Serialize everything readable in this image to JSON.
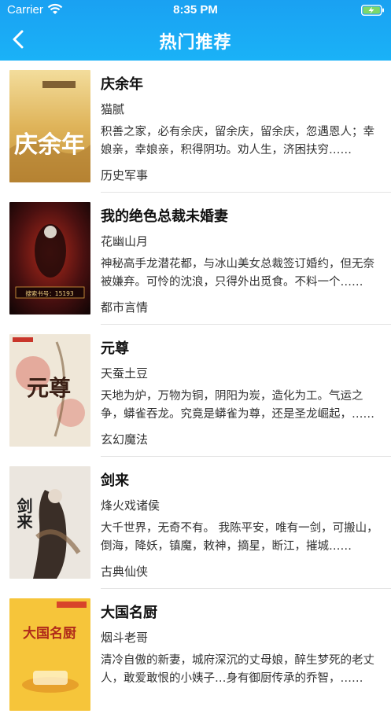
{
  "status_bar": {
    "carrier": "Carrier",
    "time": "8:35 PM"
  },
  "nav": {
    "title": "热门推荐"
  },
  "books": [
    {
      "title": "庆余年",
      "author": "猫腻",
      "description": "积善之家，必有余庆，留余庆，留余庆，忽遇恩人；幸娘亲，幸娘亲，积得阴功。劝人生，济困扶穷……",
      "genre": "历史军事",
      "cover_text": "庆余年",
      "cover_colors": [
        "#e9c67a",
        "#c89a3a"
      ]
    },
    {
      "title": "我的绝色总裁未婚妻",
      "author": "花幽山月",
      "description": "神秘高手龙潜花都，与冰山美女总裁签订婚约，但无奈被嫌弃。可怜的沈浪，只得外出觅食。不料一个……",
      "genre": "都市言情",
      "cover_text": "搜索书号：15193",
      "cover_colors": [
        "#2a0d0d",
        "#7a1a12"
      ]
    },
    {
      "title": "元尊",
      "author": "天蚕土豆",
      "description": "天地为炉，万物为铜，阴阳为炭，造化为工。气运之争，蟒雀吞龙。究竟是蟒雀为尊，还是圣龙崛起，……",
      "genre": "玄幻魔法",
      "cover_text": "元尊",
      "cover_colors": [
        "#efe6d6",
        "#c9362b"
      ]
    },
    {
      "title": "剑来",
      "author": "烽火戏诸侯",
      "description": "大千世界，无奇不有。 我陈平安，唯有一剑，可搬山，倒海，降妖，镇魔，敕神，摘星，断江，摧城……",
      "genre": "古典仙侠",
      "cover_text": "剑来",
      "cover_colors": [
        "#ece8e2",
        "#5a4a3e"
      ]
    },
    {
      "title": "大国名厨",
      "author": "烟斗老哥",
      "description": "清冷自傲的新妻，城府深沉的丈母娘，醉生梦死的老丈人，敢爱敢恨的小姨子…身有御厨传承的乔智，……",
      "genre": "",
      "cover_text": "大国名厨",
      "cover_colors": [
        "#f7c93c",
        "#e8a21a"
      ]
    }
  ]
}
